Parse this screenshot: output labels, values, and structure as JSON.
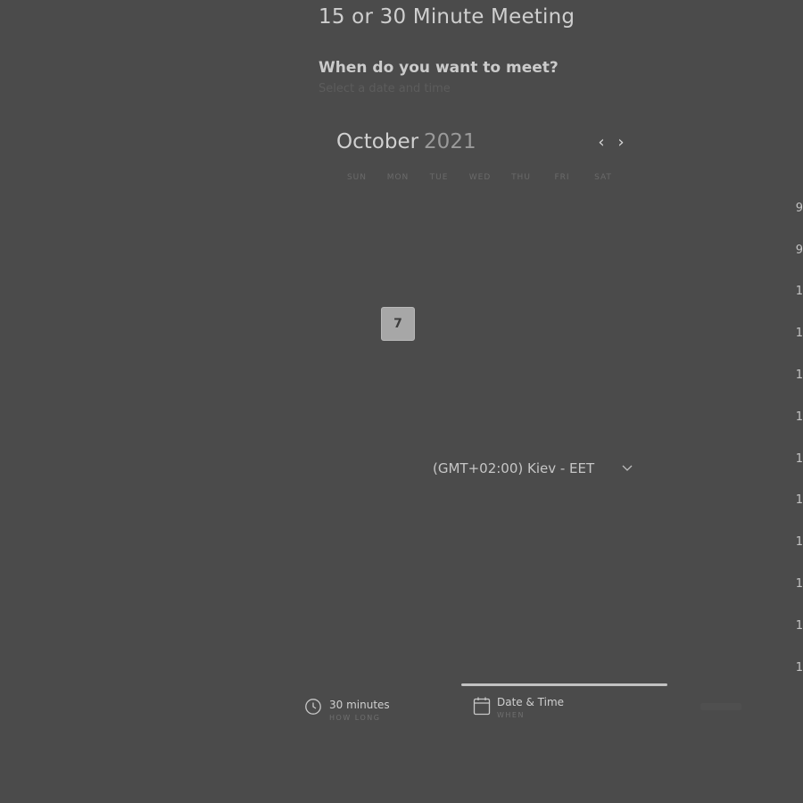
{
  "page": {
    "title": "15 or 30 Minute Meeting",
    "question": "When do you want to meet?",
    "subtext": "Select a date and time"
  },
  "calendar": {
    "month": "October",
    "year": "2021",
    "prev_icon": "chevron-left-icon",
    "next_icon": "chevron-right-icon",
    "weekdays": [
      "SUN",
      "MON",
      "TUE",
      "WED",
      "THU",
      "FRI",
      "SAT"
    ],
    "selected_day": "7"
  },
  "timezone": {
    "value": "(GMT+02:00) Kiev - EET",
    "icon": "chevron-down-icon"
  },
  "time_slots": [
    "9",
    "9",
    "1",
    "1",
    "1",
    "1",
    "1",
    "1",
    "1",
    "1",
    "1",
    "1"
  ],
  "steps": [
    {
      "label": "30 minutes",
      "sub": "HOW LONG",
      "icon": "clock-icon"
    },
    {
      "label": "Date & Time",
      "sub": "WHEN",
      "icon": "calendar-icon"
    }
  ],
  "colors": {
    "background": "#4b4b4b",
    "selected_day_bg": "#a7a7a7",
    "progress_bar": "#c2c2c2"
  }
}
